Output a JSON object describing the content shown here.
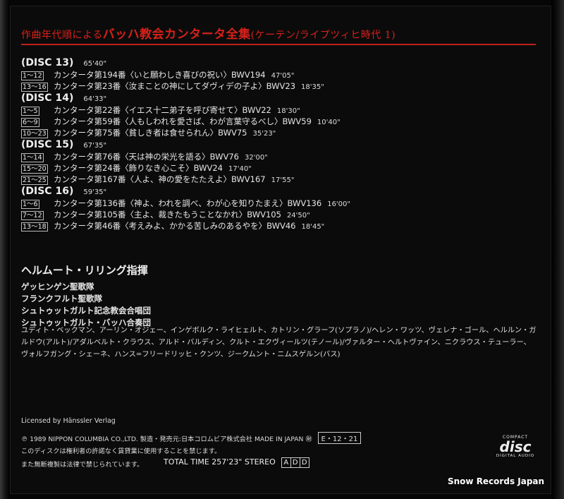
{
  "header": {
    "prefix": "作曲年代順による",
    "title": "バッハ教会カンタータ全集",
    "subtitle": "(ケーテン/ライプツィヒ時代 1)"
  },
  "discs": [
    {
      "label": "(DISC 13)",
      "time": "65'40\"",
      "tracks": [
        {
          "range": "1〜12",
          "title": "カンタータ第194番〈いと願わしき喜びの祝い〉BWV194",
          "duration": "47'05\""
        },
        {
          "range": "13〜16",
          "title": "カンタータ第23番〈汝まことの神にしてダヴィデの子よ〉BWV23",
          "duration": "18'35\""
        }
      ]
    },
    {
      "label": "(DISC 14)",
      "time": "64'33\"",
      "tracks": [
        {
          "range": "1〜5",
          "title": "カンタータ第22番〈イエス十二弟子を呼び寄せて〉BWV22",
          "duration": "18'30\""
        },
        {
          "range": "6〜9",
          "title": "カンタータ第59番〈人もしわれを愛さば、わが言葉守るべし〉BWV59",
          "duration": "10'40\""
        },
        {
          "range": "10〜23",
          "title": "カンタータ第75番〈貧しき者は食せられん〉BWV75",
          "duration": "35'23\""
        }
      ]
    },
    {
      "label": "(DISC 15)",
      "time": "67'35\"",
      "tracks": [
        {
          "range": "1〜14",
          "title": "カンタータ第76番〈天は神の栄光を語る〉BWV76",
          "duration": "32'00\""
        },
        {
          "range": "15〜20",
          "title": "カンタータ第24番〈飾りなき心こそ〉BWV24",
          "duration": "17'40\""
        },
        {
          "range": "21〜25",
          "title": "カンタータ第167番〈人よ、神の愛をたたえよ〉BWV167",
          "duration": "17'55\""
        }
      ]
    },
    {
      "label": "(DISC 16)",
      "time": "59'35\"",
      "tracks": [
        {
          "range": "1〜6",
          "title": "カンタータ第136番〈神よ、われを調べ、わが心を知りたまえ〉BWV136",
          "duration": "16'00\""
        },
        {
          "range": "7〜12",
          "title": "カンタータ第105番〈主よ、裁きたもうことなかれ〉BWV105",
          "duration": "24'50\""
        },
        {
          "range": "13〜18",
          "title": "カンタータ第46番〈考えみよ、かかる苦しみのあるやを〉BWV46",
          "duration": "18'45\""
        }
      ]
    }
  ],
  "conductor": "ヘルムート・リリング指揮",
  "choirs": [
    "ゲッヒンゲン聖歌隊",
    "フランクフルト聖歌隊",
    "シュトゥットガルト記念教会合唱団",
    "シュトゥットガルト・バッハ合奏団"
  ],
  "soloists": [
    "ユディト・ベックマン、アーリン・オジェー、インゲボルク・ライヒェルト、カトリン・グラーフ(ソプラノ)/ヘレン・ワッツ、ヴェレナ・ゴール、ヘルルン・ガ",
    "ルドウ(アルト)/アダルベルト・クラウス、アルド・バルディン、クルト・エクヴィールツ(テノール)/ヴァルター・ヘルトヴァイン、ニクラウス・テューラー、",
    "ヴォルフガング・シェーネ、ハンス=フリードリッヒ・クンツ、ジークムント・ニムスゲルン(バス)"
  ],
  "footer": {
    "license": "Licensed by Hänssler Verlag",
    "copyright": "℗ 1989 NIPPON COLUMBIA CO.,LTD. 製造・発売元:日本コロムビア株式会社 MADE IN JAPAN ㊖",
    "catalog": "E・12・21",
    "notice1": "このディスクは権利者の許諾なく賃貸業に使用することを禁じます。",
    "notice2": "また無断複製は法律で禁じられています。",
    "total_time": "TOTAL TIME 257'23\" STEREO",
    "add_code": [
      "A",
      "D",
      "D"
    ]
  },
  "cd_logo": {
    "top": "COMPACT",
    "main": "disc",
    "bottom": "DIGITAL AUDIO"
  },
  "watermark": "Snow Records Japan",
  "colors": {
    "accent_red": "#c0201a",
    "background": "#0b0b0b",
    "text": "#e6e6e6"
  }
}
